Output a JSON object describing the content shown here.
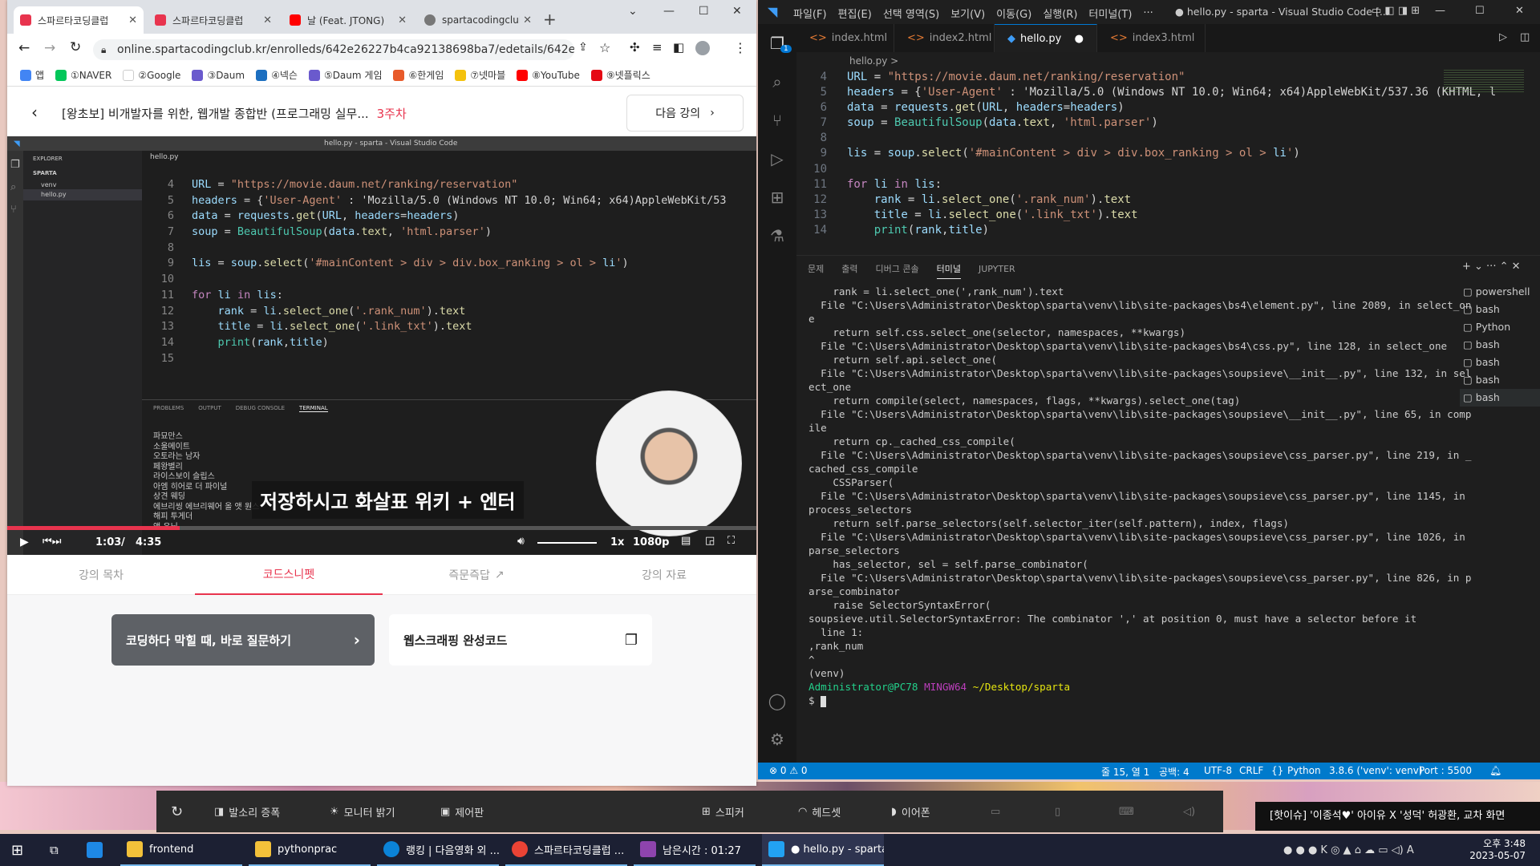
{
  "browser": {
    "tabs": [
      {
        "title": "스파르타코딩클럽",
        "active": true
      },
      {
        "title": "스파르타코딩클럽",
        "active": false
      },
      {
        "title": "날 (Feat. JTONG)",
        "active": false
      },
      {
        "title": "spartacodingclub.",
        "active": false
      }
    ],
    "url": "online.spartacodingclub.kr/enrolleds/642e26227b4ca92138698ba7/edetails/642e262...",
    "bookmarks": [
      "앱",
      "①NAVER",
      "②Google",
      "③Daum",
      "④넥슨",
      "⑤Daum 게임",
      "⑥한게임",
      "⑦넷마블",
      "⑧YouTube",
      "⑨넷플릭스"
    ]
  },
  "lecture": {
    "title": "[왕초보] 비개발자를 위한, 웹개발 종합반 (프로그래밍 실무...",
    "week": "3주차",
    "next_label": "다음 강의",
    "caption": "저장하시고 화살표 위키 + 엔터",
    "time_current": "1:03",
    "time_sep": "/",
    "time_total": "4:35",
    "progress": 0.23,
    "speed": "1x",
    "quality": "1080p",
    "tabs": [
      "강의 목차",
      "코드스니펫",
      "즉문즉답",
      "강의 자료"
    ],
    "ask_button": "코딩하다 막힐 때, 바로 질문하기",
    "code_card": "웹스크래핑 완성코드"
  },
  "video_vscode": {
    "title": "hello.py - sparta - Visual Studio Code",
    "explorer_label": "EXPLORER",
    "project": "SPARTA",
    "files": [
      "venv",
      "hello.py"
    ],
    "tab": "hello.py",
    "lines": [
      {
        "n": "4",
        "code": "URL = \"https://movie.daum.net/ranking/reservation\""
      },
      {
        "n": "5",
        "code": "headers = {'User-Agent' : 'Mozilla/5.0 (Windows NT 10.0; Win64; x64)AppleWebKit/53"
      },
      {
        "n": "6",
        "code": "data = requests.get(URL, headers=headers)"
      },
      {
        "n": "7",
        "code": "soup = BeautifulSoup(data.text, 'html.parser')"
      },
      {
        "n": "8",
        "code": ""
      },
      {
        "n": "9",
        "code": "lis = soup.select('#mainContent > div > div.box_ranking > ol > li')"
      },
      {
        "n": "10",
        "code": ""
      },
      {
        "n": "11",
        "code": "for li in lis:"
      },
      {
        "n": "12",
        "code": "    rank = li.select_one('.rank_num').text"
      },
      {
        "n": "13",
        "code": "    title = li.select_one('.link_txt').text"
      },
      {
        "n": "14",
        "code": "    print(rank,title)"
      },
      {
        "n": "15",
        "code": ""
      }
    ],
    "panel_tabs": [
      "PROBLEMS",
      "OUTPUT",
      "DEBUG CONSOLE",
      "TERMINAL"
    ],
    "terminal": [
      "파묘만스",
      "소울메이트",
      "오토라는 남자",
      "페왕별리",
      "라이스보이 슬립스",
      "아엠 히어로 더 파이널",
      "상견 웨딩",
      "에브리씽 에브리웨어 올 앳 원스",
      "해피 투게더",
      "액 유닛"
    ]
  },
  "vscode": {
    "menus": [
      "파일(F)",
      "편집(E)",
      "선택 영역(S)",
      "보기(V)",
      "이동(G)",
      "실행(R)",
      "터미널(T)",
      "···"
    ],
    "window_title": "● hello.py - sparta - Visual Studio Code [...",
    "tabs": [
      "index.html",
      "index2.html",
      "hello.py",
      "index3.html"
    ],
    "breadcrumb": "hello.py >",
    "lines": [
      {
        "n": "4",
        "code": "URL = \"https://movie.daum.net/ranking/reservation\""
      },
      {
        "n": "5",
        "code": "headers = {'User-Agent' : 'Mozilla/5.0 (Windows NT 10.0; Win64; x64)AppleWebKit/537.36 (KHTML, l"
      },
      {
        "n": "6",
        "code": "data = requests.get(URL, headers=headers)"
      },
      {
        "n": "7",
        "code": "soup = BeautifulSoup(data.text, 'html.parser')"
      },
      {
        "n": "8",
        "code": ""
      },
      {
        "n": "9",
        "code": "lis = soup.select('#mainContent > div > div.box_ranking > ol > li')"
      },
      {
        "n": "10",
        "code": ""
      },
      {
        "n": "11",
        "code": "for li in lis:"
      },
      {
        "n": "12",
        "code": "    rank = li.select_one('.rank_num').text"
      },
      {
        "n": "13",
        "code": "    title = li.select_one('.link_txt').text"
      },
      {
        "n": "14",
        "code": "    print(rank,title)"
      }
    ],
    "panel_tabs": [
      "문제",
      "출력",
      "디버그 콘솔",
      "터미널",
      "JUPYTER"
    ],
    "terminal": [
      "    rank = li.select_one(',rank_num').text",
      "  File \"C:\\Users\\Administrator\\Desktop\\sparta\\venv\\lib\\site-packages\\bs4\\element.py\", line 2089, in select_on",
      "e",
      "    return self.css.select_one(selector, namespaces, **kwargs)",
      "  File \"C:\\Users\\Administrator\\Desktop\\sparta\\venv\\lib\\site-packages\\bs4\\css.py\", line 128, in select_one",
      "    return self.api.select_one(",
      "  File \"C:\\Users\\Administrator\\Desktop\\sparta\\venv\\lib\\site-packages\\soupsieve\\__init__.py\", line 132, in sel",
      "ect_one",
      "    return compile(select, namespaces, flags, **kwargs).select_one(tag)",
      "  File \"C:\\Users\\Administrator\\Desktop\\sparta\\venv\\lib\\site-packages\\soupsieve\\__init__.py\", line 65, in comp",
      "ile",
      "    return cp._cached_css_compile(",
      "  File \"C:\\Users\\Administrator\\Desktop\\sparta\\venv\\lib\\site-packages\\soupsieve\\css_parser.py\", line 219, in _",
      "cached_css_compile",
      "    CSSParser(",
      "  File \"C:\\Users\\Administrator\\Desktop\\sparta\\venv\\lib\\site-packages\\soupsieve\\css_parser.py\", line 1145, in",
      "process_selectors",
      "    return self.parse_selectors(self.selector_iter(self.pattern), index, flags)",
      "  File \"C:\\Users\\Administrator\\Desktop\\sparta\\venv\\lib\\site-packages\\soupsieve\\css_parser.py\", line 1026, in",
      "parse_selectors",
      "    has_selector, sel = self.parse_combinator(",
      "  File \"C:\\Users\\Administrator\\Desktop\\sparta\\venv\\lib\\site-packages\\soupsieve\\css_parser.py\", line 826, in p",
      "arse_combinator",
      "    raise SelectorSyntaxError(",
      "soupsieve.util.SelectorSyntaxError: The combinator ',' at position 0, must have a selector before it",
      "  line 1:",
      ",rank_num",
      "^",
      "(venv)"
    ],
    "prompt_user": "Administrator@PC78",
    "prompt_shell": "MINGW64",
    "prompt_path": "~/Desktop/sparta",
    "prompt_symbol": "$",
    "terminal_list": [
      "powershell",
      "bash",
      "Python",
      "bash",
      "bash",
      "bash",
      "bash"
    ],
    "status": {
      "errors": "⊗ 0 ⚠ 0",
      "position": "줄 15, 열 1",
      "spaces": "공백: 4",
      "encoding": "UTF-8",
      "eol": "CRLF",
      "language": "Python",
      "interpreter": "3.8.6 ('venv': venv)",
      "port": "Port : 5500"
    }
  },
  "callbar": {
    "items": [
      "발소리 증폭",
      "모니터 밝기",
      "제어판",
      "스피커",
      "헤드셋",
      "이어폰"
    ]
  },
  "news": "[핫이슈] '이종석♥' 아이유 X '성덕' 허광환, 교차 화면",
  "taskbar": {
    "apps": [
      "frontend",
      "pythonprac",
      "랭킹 | 다음영화 외 ...",
      "스파르타코딩클럽 ...",
      "남은시간 : 01:27",
      "● hello.py - sparta..."
    ],
    "time": "오후 3:48",
    "date": "2023-05-07"
  },
  "colors": {
    "accent": "#e8344e",
    "vscode_blue": "#007acc"
  }
}
